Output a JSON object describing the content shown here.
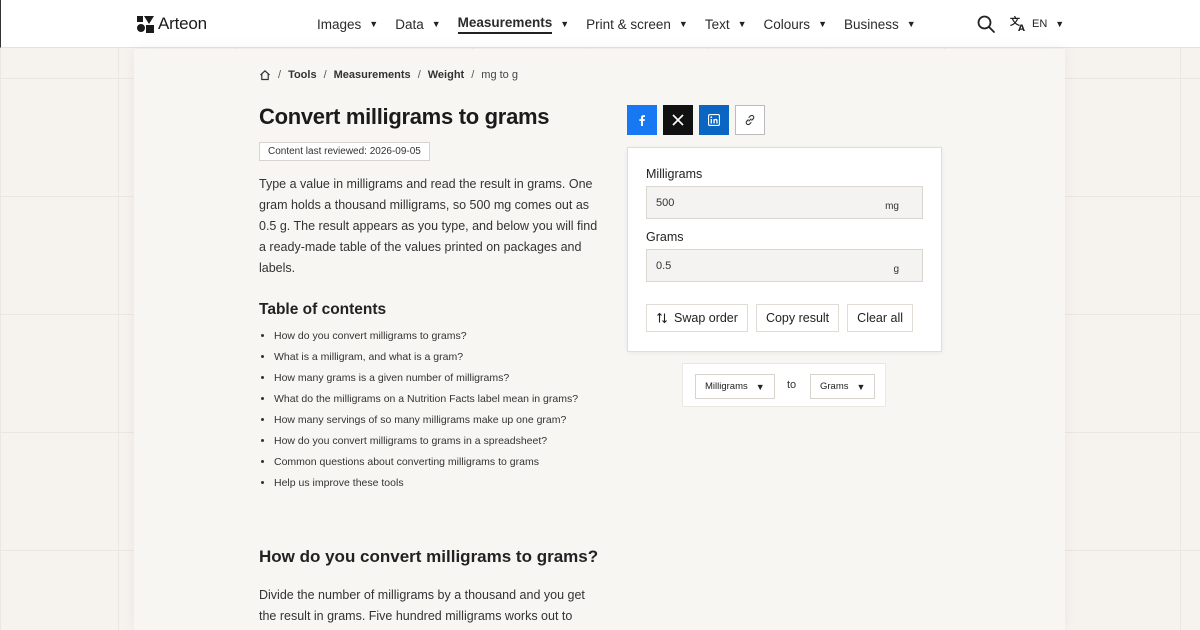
{
  "brand": {
    "name": "Arteon"
  },
  "nav": {
    "items": [
      {
        "label": "Images",
        "active": false
      },
      {
        "label": "Data",
        "active": false
      },
      {
        "label": "Measurements",
        "active": true
      },
      {
        "label": "Print & screen",
        "active": false
      },
      {
        "label": "Text",
        "active": false
      },
      {
        "label": "Colours",
        "active": false
      },
      {
        "label": "Business",
        "active": false
      }
    ],
    "caret": "▼",
    "language": "EN"
  },
  "breadcrumb": {
    "separator": "/",
    "items": [
      "Tools",
      "Measurements",
      "Weight"
    ],
    "current": "mg to g"
  },
  "page": {
    "title": "Convert milligrams to grams",
    "reviewed": "Content last reviewed: 2026-09-05",
    "intro": "Type a value in milligrams and read the result in grams. One gram holds a thousand milligrams, so 500 mg comes out as 0.5 g. The result appears as you type, and below you will find a ready-made table of the values printed on packages and labels."
  },
  "toc": {
    "title": "Table of contents",
    "items": [
      "How do you convert milligrams to grams?",
      "What is a milligram, and what is a gram?",
      "How many grams is a given number of milligrams?",
      "What do the milligrams on a Nutrition Facts label mean in grams?",
      "How many servings of so many milligrams make up one gram?",
      "How do you convert milligrams to grams in a spreadsheet?",
      "Common questions about converting milligrams to grams",
      "Help us improve these tools"
    ]
  },
  "section": {
    "heading": "How do you convert milligrams to grams?",
    "text": "Divide the number of milligrams by a thousand and you get the result in grams. Five hundred milligrams works out to"
  },
  "converter": {
    "from_label": "Milligrams",
    "from_value": "500",
    "from_unit": "mg",
    "to_label": "Grams",
    "to_value": "0.5",
    "to_unit": "g",
    "swap_label": "Swap order",
    "copy_label": "Copy result",
    "clear_label": "Clear all"
  },
  "unit_select": {
    "from": "Milligrams",
    "to_word": "to",
    "to": "Grams"
  },
  "colors": {
    "facebook": "#1877f2",
    "x": "#111111",
    "linkedin": "#0a66c2",
    "background": "#f6f3ee"
  },
  "icons": {
    "logo": "arteon-logo-icon",
    "search": "search-icon",
    "language": "translate-icon",
    "home": "home-icon",
    "facebook": "facebook-icon",
    "x": "x-icon",
    "linkedin": "linkedin-icon",
    "link": "link-icon",
    "swap": "swap-icon"
  }
}
